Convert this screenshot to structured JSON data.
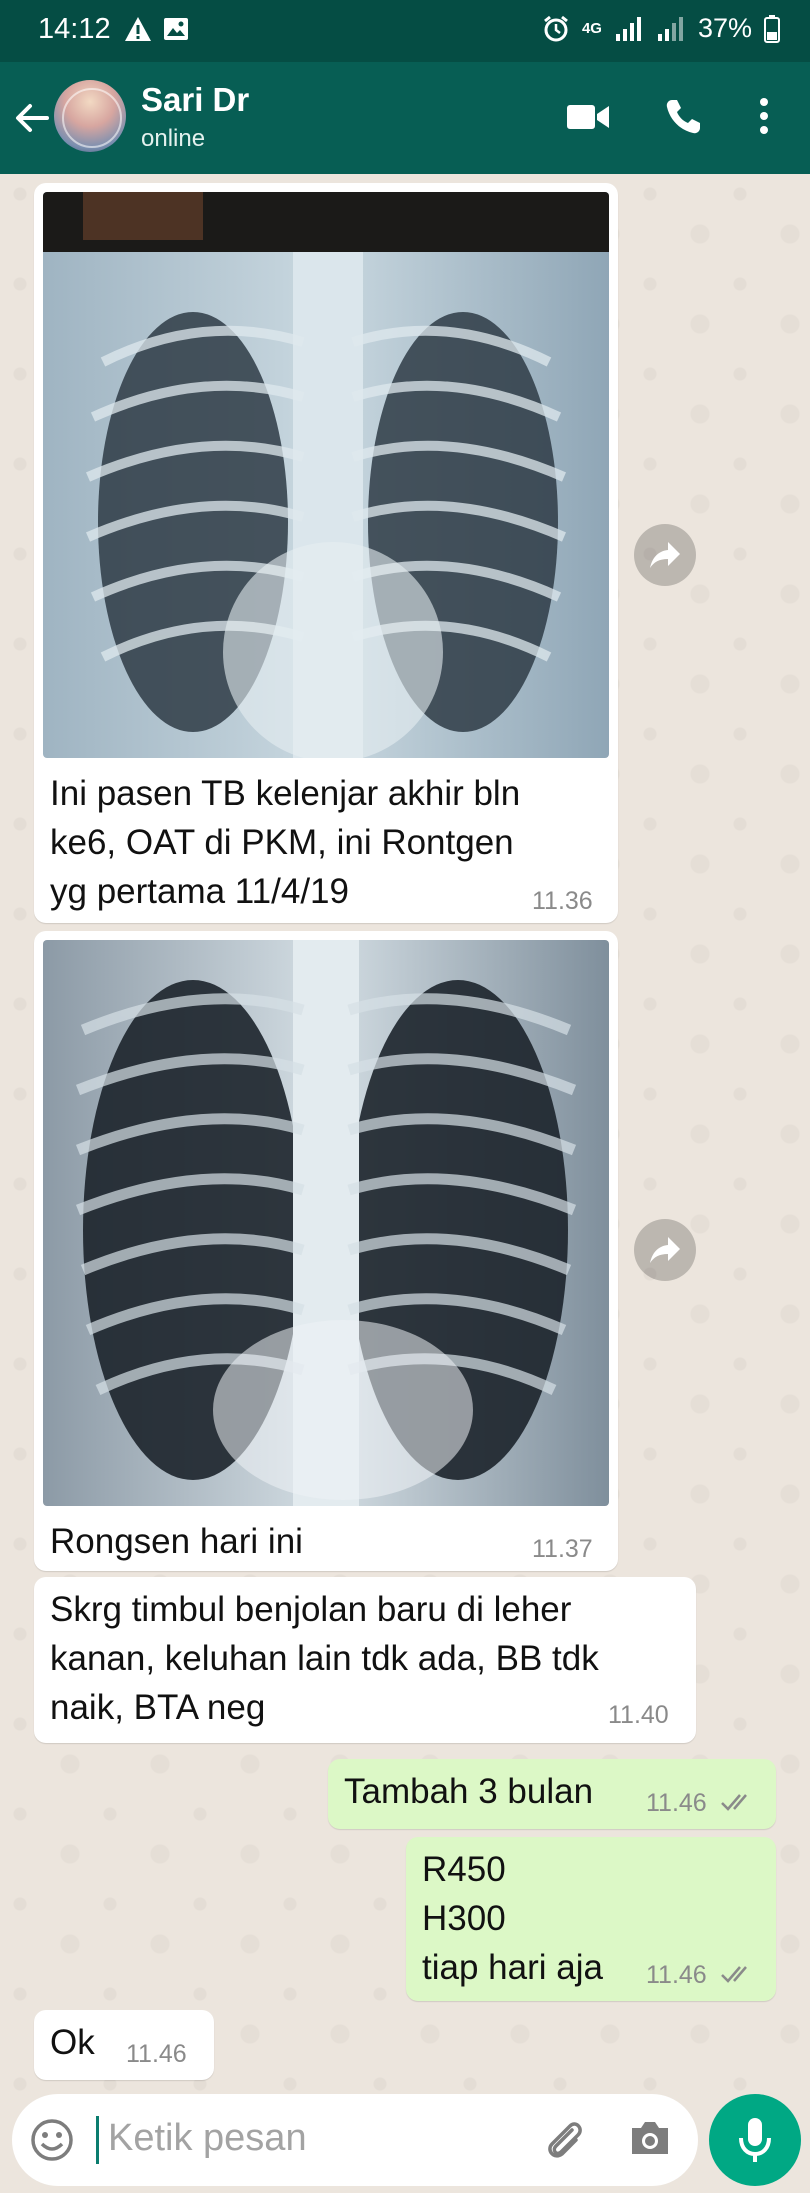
{
  "status_bar": {
    "time": "14:12",
    "network": "4G",
    "battery": "37%"
  },
  "header": {
    "name": "Sari Dr",
    "status": "online",
    "icons": [
      "back-arrow-icon",
      "video-call-icon",
      "phone-icon",
      "more-vert-icon"
    ],
    "color": "#075e54"
  },
  "messages": [
    {
      "type": "image",
      "direction": "in",
      "caption": "Ini pasen TB kelenjar akhir bln\nke6, OAT di PKM, ini Rontgen\nyg pertama 11/4/19",
      "time": "11.36"
    },
    {
      "type": "image",
      "direction": "in",
      "caption": "Rongsen hari ini",
      "time": "11.37"
    },
    {
      "type": "text",
      "direction": "in",
      "text": "Skrg timbul benjolan baru di leher\nkanan, keluhan lain tdk ada, BB tdk\nnaik, BTA neg",
      "time": "11.40"
    },
    {
      "type": "text",
      "direction": "out",
      "text": "Tambah 3 bulan",
      "time": "11.46"
    },
    {
      "type": "text",
      "direction": "out",
      "text": "R450\nH300\ntiap hari aja",
      "time": "11.46"
    },
    {
      "type": "text",
      "direction": "in",
      "text": "Ok",
      "time": "11.46"
    }
  ],
  "input": {
    "placeholder": "Ketik pesan"
  },
  "colors": {
    "outgoing_bubble": "#dcf8c6",
    "incoming_bubble": "#ffffff",
    "read_tick": "#8a8a8a",
    "mic_button": "#00a884"
  }
}
